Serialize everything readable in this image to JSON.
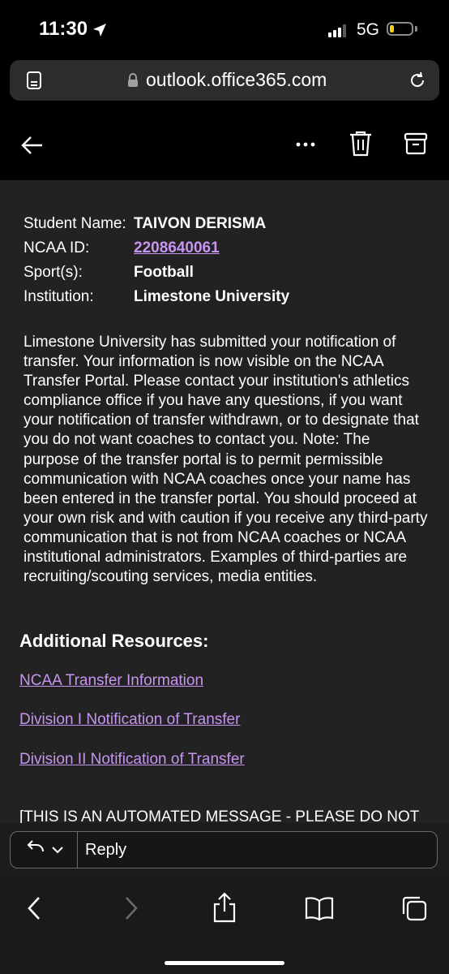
{
  "status_bar": {
    "time": "11:30",
    "network": "5G"
  },
  "browser": {
    "url": "outlook.office365.com"
  },
  "email": {
    "fields": [
      {
        "key": "Student Name:",
        "value": "TAIVON DERISMA",
        "link": false
      },
      {
        "key": "NCAA ID:",
        "value": "2208640061",
        "link": true
      },
      {
        "key": "Sport(s):",
        "value": "Football",
        "link": false
      },
      {
        "key": "Institution:",
        "value": "Limestone University",
        "link": false
      }
    ],
    "body": "Limestone University has submitted your notification of transfer. Your information is now visible on the NCAA Transfer Portal. Please contact your institution's athletics compliance office if you have any questions, if you want your notification of transfer withdrawn, or to designate that you do not want coaches to contact you. Note: The purpose of the transfer portal is to permit permissible communication with NCAA coaches once your name has been entered in the transfer portal. You should proceed at your own risk and with caution if you receive any third-party communication that is not from NCAA coaches or NCAA institutional administrators. Examples of third-parties are recruiting/scouting services, media entities.",
    "resources_title": "Additional Resources:",
    "resources": [
      "NCAA Transfer Information",
      "Division I Notification of Transfer",
      "Division II Notification of Transfer"
    ],
    "automated_notice": "[THIS IS AN AUTOMATED MESSAGE - PLEASE DO NOT"
  },
  "reply": {
    "label": "Reply"
  },
  "icons": {
    "status": [
      "location-arrow-icon",
      "signal-bars-icon",
      "battery-icon"
    ],
    "urlbar": [
      "reader-mode-icon",
      "lock-icon",
      "reload-icon"
    ],
    "header": [
      "back-arrow-icon",
      "more-icon",
      "trash-icon",
      "archive-icon"
    ],
    "toolbar": [
      "browser-back-icon",
      "browser-forward-icon",
      "share-icon",
      "bookmarks-icon",
      "tabs-icon"
    ]
  },
  "colors": {
    "link": "#c794f0",
    "battery": "#f5cc1a",
    "email_background": "#222222"
  }
}
